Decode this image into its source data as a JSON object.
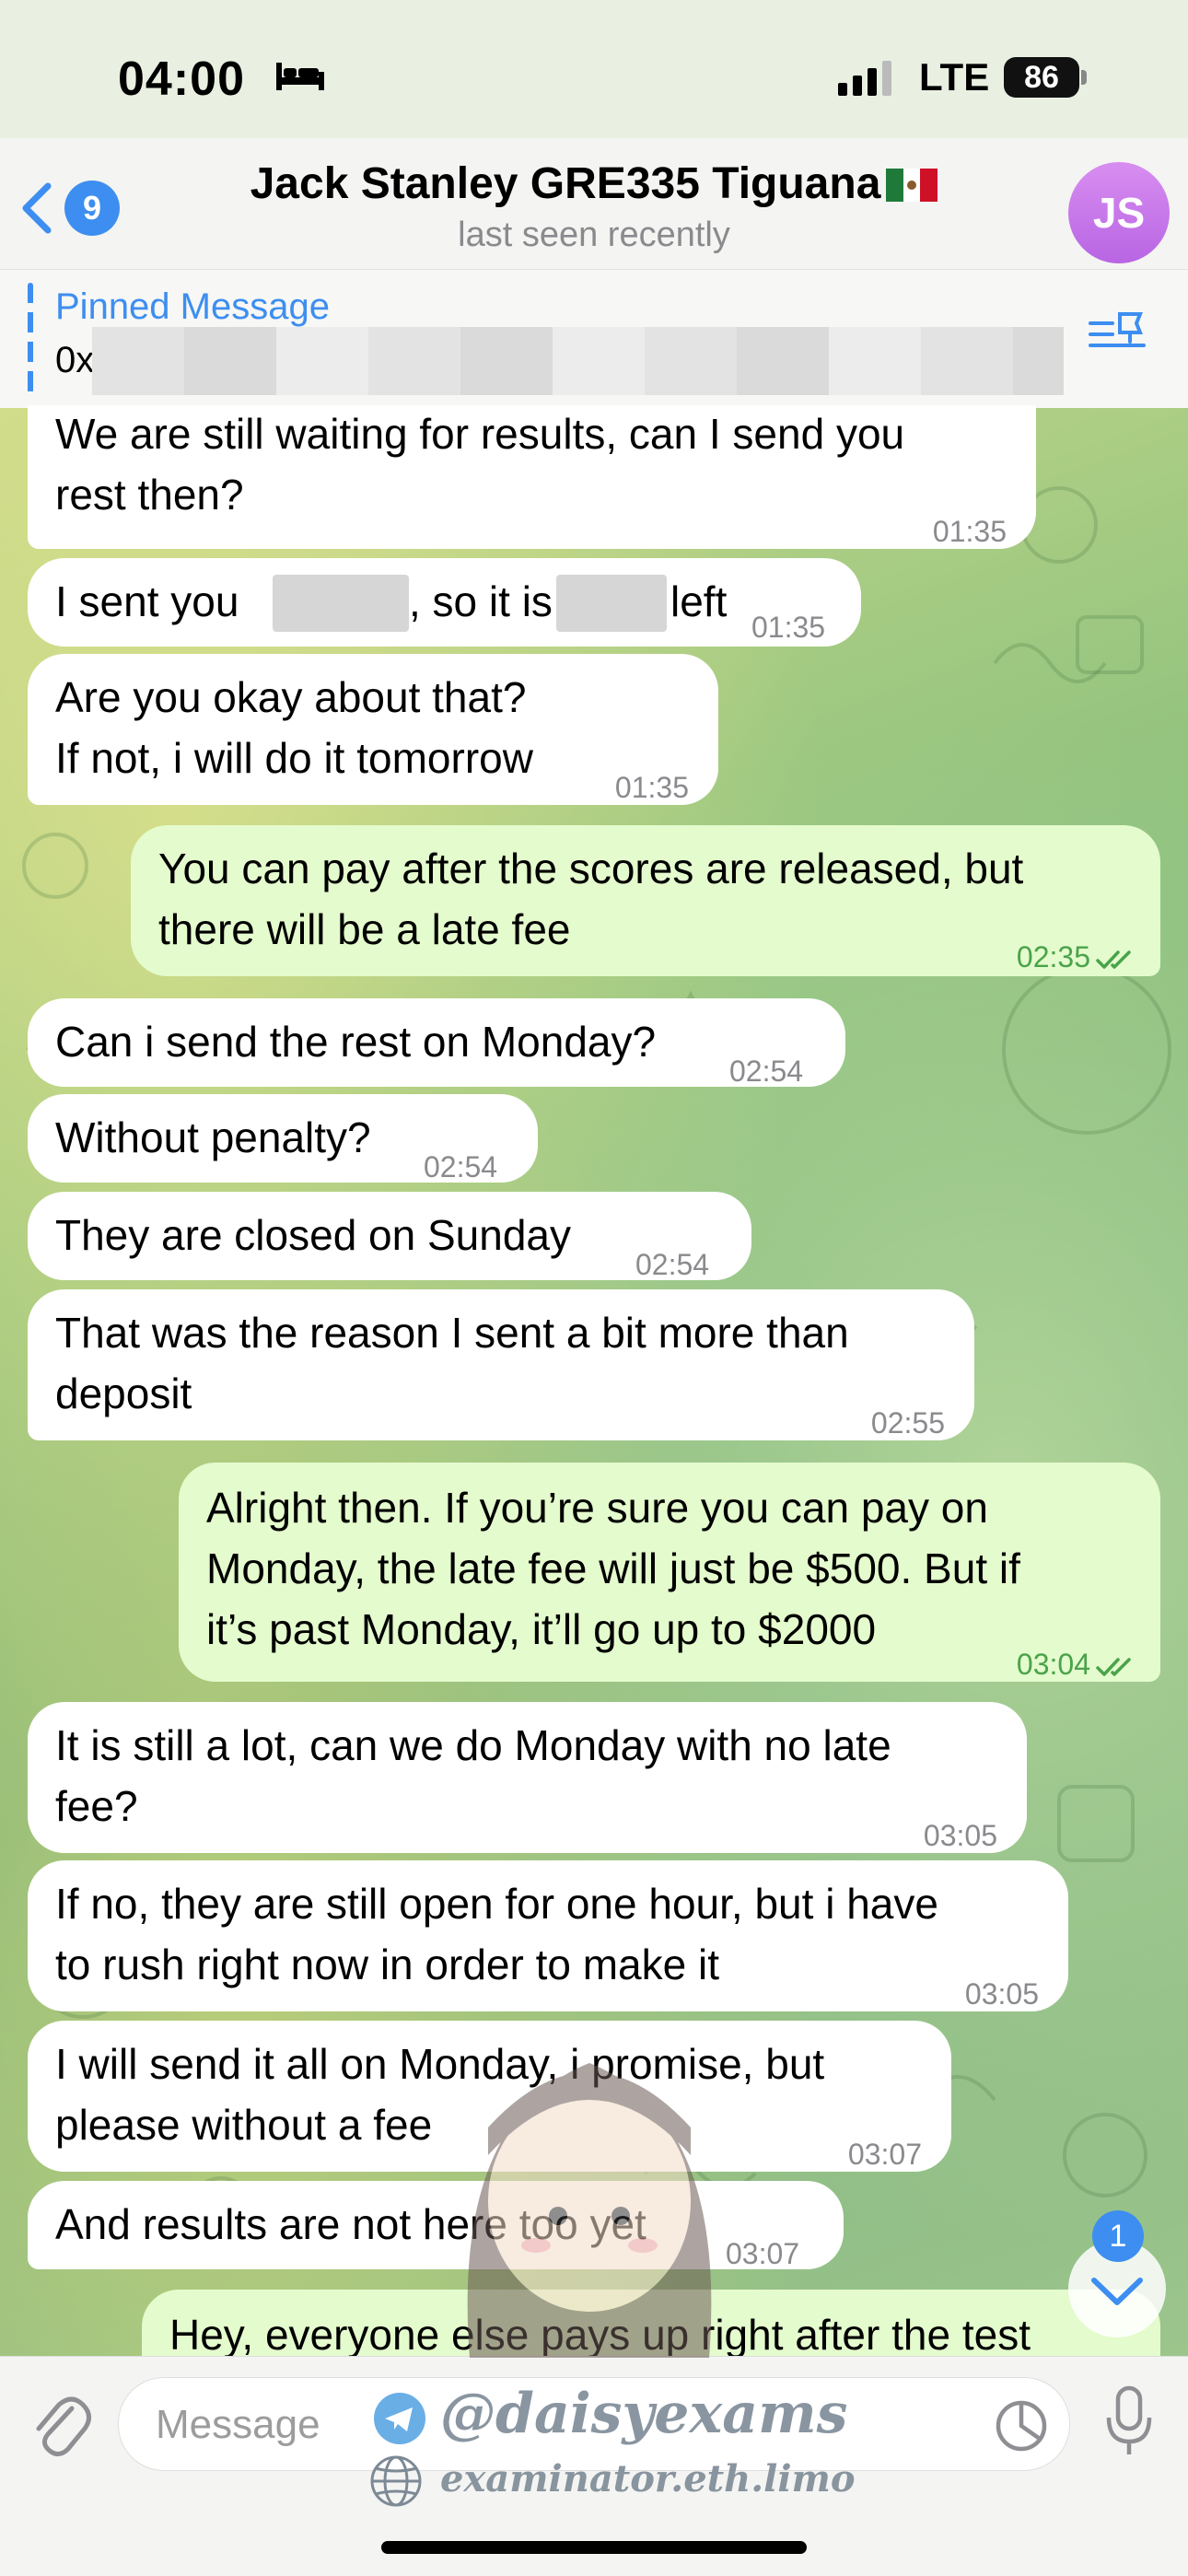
{
  "status_bar": {
    "time": "04:00",
    "network": "LTE",
    "battery": "86"
  },
  "header": {
    "back_badge": "9",
    "title": "Jack Stanley GRE335 Tiguana",
    "subtitle": "last seen recently",
    "avatar_initials": "JS"
  },
  "pinned": {
    "label": "Pinned Message",
    "text_visible": "0x"
  },
  "messages": [
    {
      "dir": "in",
      "text": "We are still waiting for results, can I send you\nrest then?",
      "time": "01:35"
    },
    {
      "dir": "in",
      "text_a": "I sent you",
      "text_b": ", so it is",
      "text_c": "left",
      "time": "01:35"
    },
    {
      "dir": "in",
      "text": "Are you okay about that?\nIf not, i will do it tomorrow",
      "time": "01:35"
    },
    {
      "dir": "out",
      "text": "You can pay after the scores are released, but\nthere will be a late fee",
      "time": "02:35"
    },
    {
      "dir": "in",
      "text": "Can i send the rest on Monday?",
      "time": "02:54"
    },
    {
      "dir": "in",
      "text": "Without penalty?",
      "time": "02:54"
    },
    {
      "dir": "in",
      "text": "They are closed on Sunday",
      "time": "02:54"
    },
    {
      "dir": "in",
      "text": "That was the reason I sent a bit more than\ndeposit",
      "time": "02:55"
    },
    {
      "dir": "out",
      "text": "Alright then. If you’re sure you can pay on\nMonday, the late fee will just be $500. But if\nit’s past Monday, it’ll go up to $2000",
      "time": "03:04"
    },
    {
      "dir": "in",
      "text": "It is still a lot, can we do Monday with no late\nfee?",
      "time": "03:05"
    },
    {
      "dir": "in",
      "text": "If no, they are still open for one hour, but i have\nto rush right now in order to make it",
      "time": "03:05"
    },
    {
      "dir": "in",
      "text": "I will send it all on Monday, i promise, but\nplease without a fee",
      "time": "03:07"
    },
    {
      "dir": "in",
      "text": "And results are not here too yet",
      "time": "03:07"
    },
    {
      "dir": "out",
      "text": "Hey, everyone else pays up right after the test",
      "time": ""
    }
  ],
  "scroll_down_badge": "1",
  "input": {
    "placeholder": "Message"
  },
  "watermark": {
    "handle": "@daisyexams",
    "url": "examinator.eth.limo"
  },
  "colors": {
    "accent": "#3d8ef0",
    "outgoing_bubble": "#e4fbcd",
    "incoming_bubble": "#ffffff",
    "avatar": "#c97ae8"
  },
  "icons": [
    "bed-icon",
    "signal-icon",
    "back-chevron-icon",
    "mexico-flag-icon",
    "pin-list-icon",
    "double-check-icon",
    "attach-icon",
    "sticker-icon",
    "mic-icon",
    "chevron-down-icon",
    "telegram-icon",
    "globe-icon"
  ]
}
